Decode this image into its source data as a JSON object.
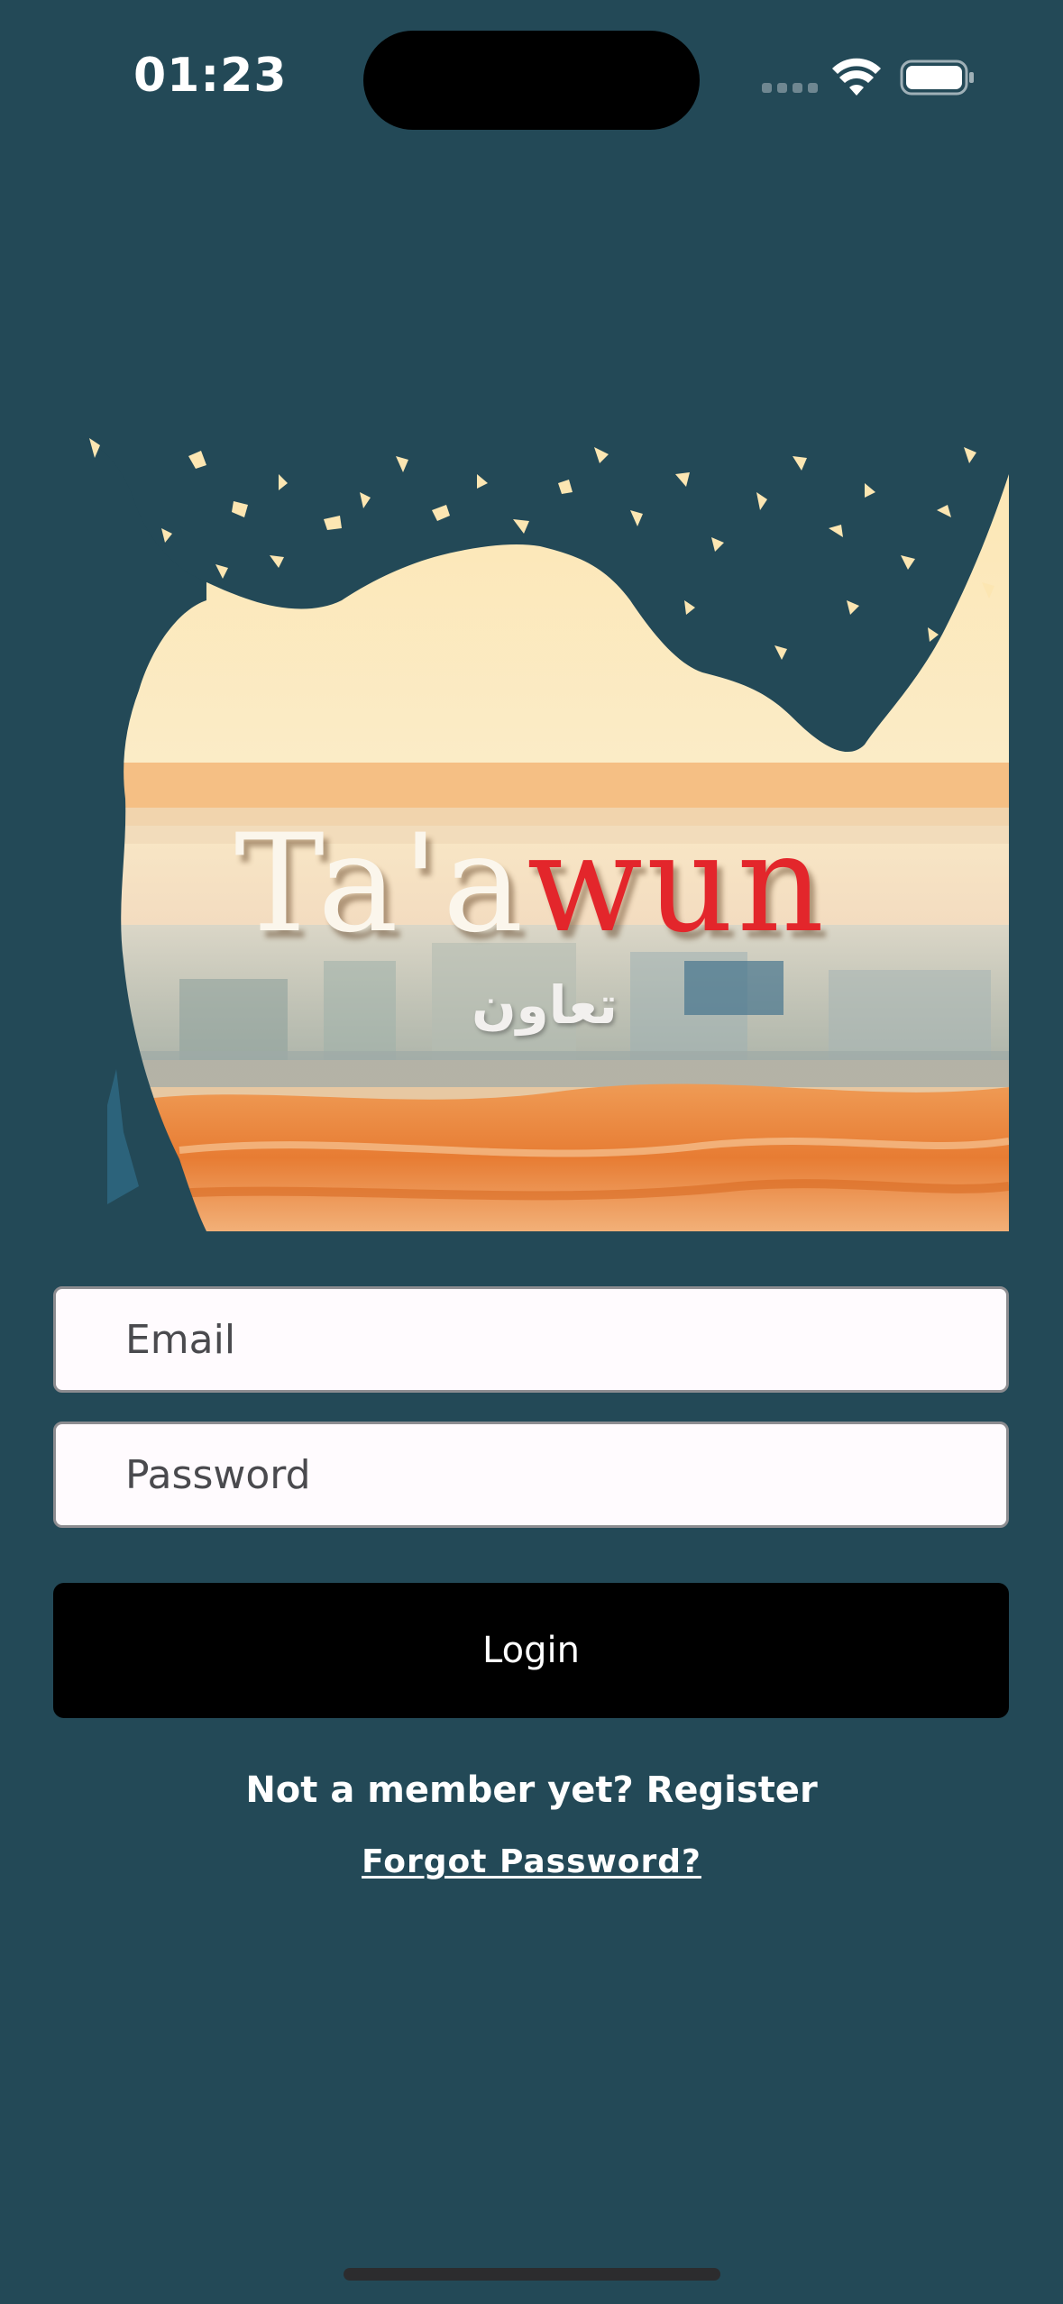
{
  "status_bar": {
    "time": "01:23",
    "icons": [
      "signal-dots-icon",
      "wifi-icon",
      "battery-icon"
    ]
  },
  "hero": {
    "title_light": "Ta'a",
    "title_red": "wun",
    "subtitle": "تعاون"
  },
  "form": {
    "email_placeholder": "Email",
    "password_placeholder": "Password",
    "login_label": "Login",
    "register_text": "Not a member yet? Register",
    "forgot_label": "Forgot Password?"
  },
  "colors": {
    "background": "#234957",
    "button": "#000000",
    "input_bg": "#fffbfe",
    "title_accent": "#e3262b",
    "sky": "#fbeac2"
  }
}
